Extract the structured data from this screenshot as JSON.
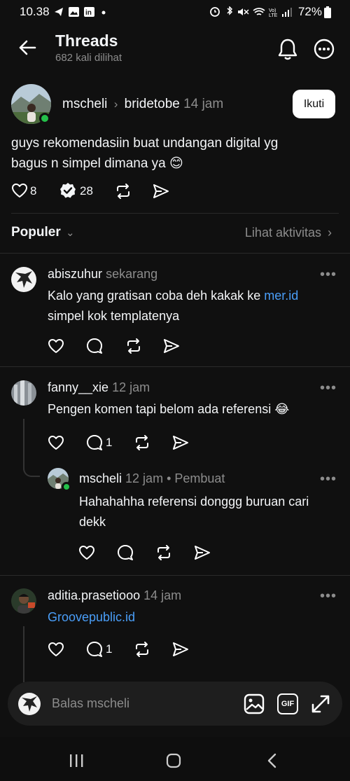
{
  "status_bar": {
    "time": "10.38",
    "battery": "72%"
  },
  "header": {
    "title": "Threads",
    "views": "682 kali dilihat"
  },
  "post": {
    "author": "mscheli",
    "community": "bridetobe",
    "time": "14 jam",
    "follow_label": "Ikuti",
    "text_line1": "guys rekomendasiin buat undangan digital yg",
    "text_line2": "bagus n simpel dimana ya 😊",
    "likes": "8",
    "replies": "28"
  },
  "sort": {
    "label": "Populer",
    "activity_link": "Lihat aktivitas"
  },
  "comments": [
    {
      "author": "abiszuhur",
      "time": "sekarang",
      "text_line1_pre": "Kalo yang gratisan coba deh kakak ke ",
      "text_line1_link": "mer.id",
      "text_line2": "simpel kok templatenya"
    },
    {
      "author": "fanny__xie",
      "time": "12 jam",
      "text": "Pengen komen tapi belom ada referensi 😂",
      "reply_count": "1"
    },
    {
      "author": "mscheli",
      "time": "12 jam",
      "badge": "• Pembuat",
      "text_line1": "Hahahahha referensi donggg buruan cari",
      "text_line2": "dekk"
    },
    {
      "author": "aditia.prasetiooo",
      "time": "14 jam",
      "text_link": "Groovepublic.id",
      "reply_count": "1"
    }
  ],
  "reply_bar": {
    "placeholder": "Balas mscheli",
    "gif_label": "GIF"
  },
  "icons": {
    "back": "arrow-left-icon",
    "bell": "bell-icon",
    "more": "more-circle-icon",
    "heart": "heart-icon",
    "reply": "comment-icon",
    "repost": "repost-icon",
    "share": "send-icon"
  }
}
